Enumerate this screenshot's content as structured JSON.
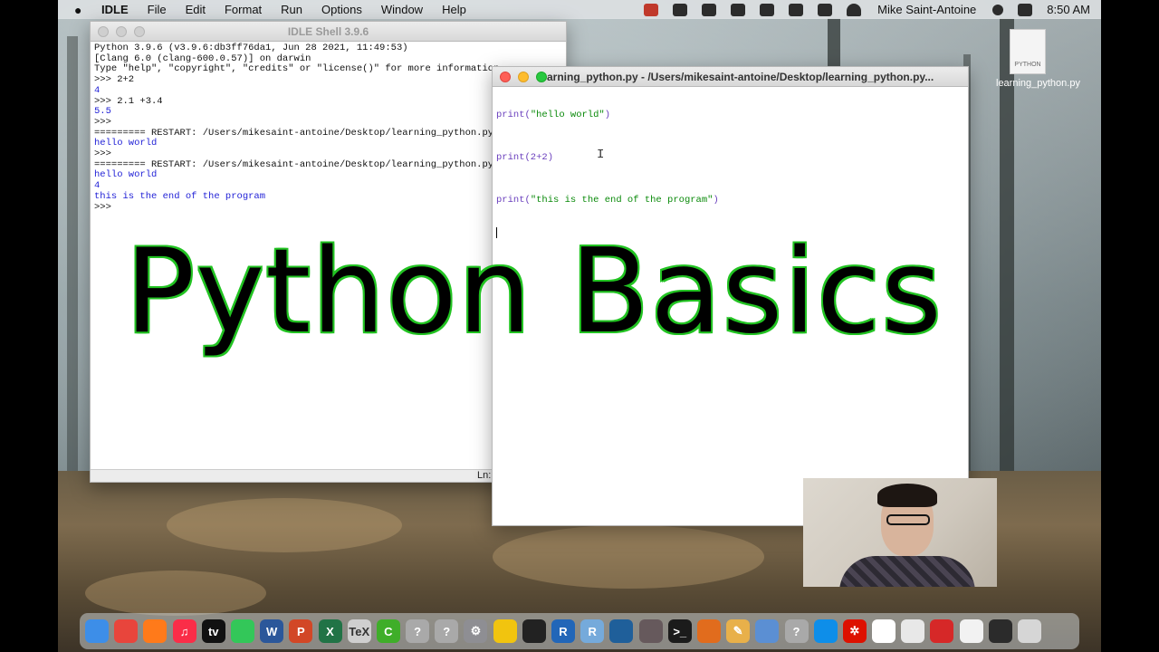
{
  "menubar": {
    "app_name": "IDLE",
    "menus": [
      "File",
      "Edit",
      "Format",
      "Run",
      "Options",
      "Window",
      "Help"
    ],
    "user": "Mike Saint-Antoine",
    "time": "8:50 AM"
  },
  "shell": {
    "title": "IDLE Shell 3.9.6",
    "lines": [
      {
        "text": "Python 3.9.6 (v3.9.6:db3ff76da1, Jun 28 2021, 11:49:53)",
        "color": "dark"
      },
      {
        "text": "[Clang 6.0 (clang-600.0.57)] on darwin",
        "color": "dark"
      },
      {
        "text": "Type \"help\", \"copyright\", \"credits\" or \"license()\" for more information.",
        "color": "dark"
      },
      {
        "text": ">>> 2+2",
        "color": "dark"
      },
      {
        "text": "4",
        "color": "blue"
      },
      {
        "text": ">>> 2.1 +3.4",
        "color": "dark"
      },
      {
        "text": "5.5",
        "color": "blue"
      },
      {
        "text": ">>>",
        "color": "dark"
      },
      {
        "text": "========= RESTART: /Users/mikesaint-antoine/Desktop/learning_python.py =",
        "color": "dark"
      },
      {
        "text": "hello world",
        "color": "blue"
      },
      {
        "text": ">>>",
        "color": "dark"
      },
      {
        "text": "========= RESTART: /Users/mikesaint-antoine/Desktop/learning_python.py =",
        "color": "dark"
      },
      {
        "text": "hello world",
        "color": "blue"
      },
      {
        "text": "4",
        "color": "blue"
      },
      {
        "text": "this is the end of the program",
        "color": "blue"
      },
      {
        "text": ">>>",
        "color": "dark"
      }
    ],
    "status": "Ln:"
  },
  "editor": {
    "title": "learning_python.py - /Users/mikesaint-antoine/Desktop/learning_python.py...",
    "code": [
      {
        "prefix": "print(",
        "str": "\"hello world\"",
        "suffix": ")"
      },
      {
        "prefix": "print(2+2)",
        "str": "",
        "suffix": ""
      },
      {
        "prefix": "print(",
        "str": "\"this is the end of the program\"",
        "suffix": ")"
      }
    ]
  },
  "overlay": {
    "title": "Python Basics"
  },
  "desktop_file": {
    "icon_label": "PYTHON",
    "name": "learning_python.py"
  },
  "colors": {
    "overlay_outline": "#22c322",
    "shell_output": "#1f1fd6",
    "string": "#0a8a0a"
  },
  "dock": {
    "apps": [
      {
        "name": "finder-icon",
        "color": "#3d8ee8",
        "glyph": ""
      },
      {
        "name": "chrome-icon",
        "color": "#e8453c",
        "glyph": ""
      },
      {
        "name": "firefox-icon",
        "color": "#ff7a1a",
        "glyph": ""
      },
      {
        "name": "music-icon",
        "color": "#fa2d48",
        "glyph": "♫"
      },
      {
        "name": "apple-tv-icon",
        "color": "#111111",
        "glyph": "tv"
      },
      {
        "name": "messages-icon",
        "color": "#33c759",
        "glyph": ""
      },
      {
        "name": "word-icon",
        "color": "#2b579a",
        "glyph": "W"
      },
      {
        "name": "powerpoint-icon",
        "color": "#d24726",
        "glyph": "P"
      },
      {
        "name": "excel-icon",
        "color": "#217346",
        "glyph": "X"
      },
      {
        "name": "texmaker-icon",
        "color": "#cfcfcf",
        "glyph": "TeX"
      },
      {
        "name": "camtasia-icon",
        "color": "#3fae29",
        "glyph": "C"
      },
      {
        "name": "unknown-app-icon",
        "color": "#a9a9a9",
        "glyph": "?"
      },
      {
        "name": "unknown-app-icon",
        "color": "#a9a9a9",
        "glyph": "?"
      },
      {
        "name": "system-preferences-icon",
        "color": "#8e8e93",
        "glyph": "⚙"
      },
      {
        "name": "rhino-icon",
        "color": "#f1c40f",
        "glyph": ""
      },
      {
        "name": "inkscape-icon",
        "color": "#222222",
        "glyph": ""
      },
      {
        "name": "r-icon",
        "color": "#2266b8",
        "glyph": "R"
      },
      {
        "name": "rstudio-icon",
        "color": "#75aadb",
        "glyph": "R"
      },
      {
        "name": "mysql-workbench-icon",
        "color": "#1f5f9a",
        "glyph": ""
      },
      {
        "name": "atom-icon",
        "color": "#66595c",
        "glyph": ""
      },
      {
        "name": "terminal-icon",
        "color": "#1b1b1b",
        "glyph": ">_"
      },
      {
        "name": "matlab-icon",
        "color": "#e16c1d",
        "glyph": ""
      },
      {
        "name": "pencil-icon",
        "color": "#e8b04a",
        "glyph": "✎"
      },
      {
        "name": "preview-icon",
        "color": "#5b8fd3",
        "glyph": ""
      },
      {
        "name": "unknown-app-icon",
        "color": "#a9a9a9",
        "glyph": "?"
      },
      {
        "name": "teamviewer-icon",
        "color": "#0e8ee9",
        "glyph": ""
      },
      {
        "name": "wolfram-icon",
        "color": "#dd1100",
        "glyph": "✲"
      },
      {
        "name": "slack-icon",
        "color": "#ffffff",
        "glyph": ""
      },
      {
        "name": "python-launcher-icon",
        "color": "#e8e8e8",
        "glyph": ""
      },
      {
        "name": "ink-app-icon",
        "color": "#d62828",
        "glyph": ""
      },
      {
        "name": "document-icon",
        "color": "#f2f2f2",
        "glyph": ""
      },
      {
        "name": "window-thumbnail-icon",
        "color": "#2b2b2b",
        "glyph": ""
      },
      {
        "name": "trash-icon",
        "color": "#d6d6d6",
        "glyph": ""
      }
    ]
  }
}
